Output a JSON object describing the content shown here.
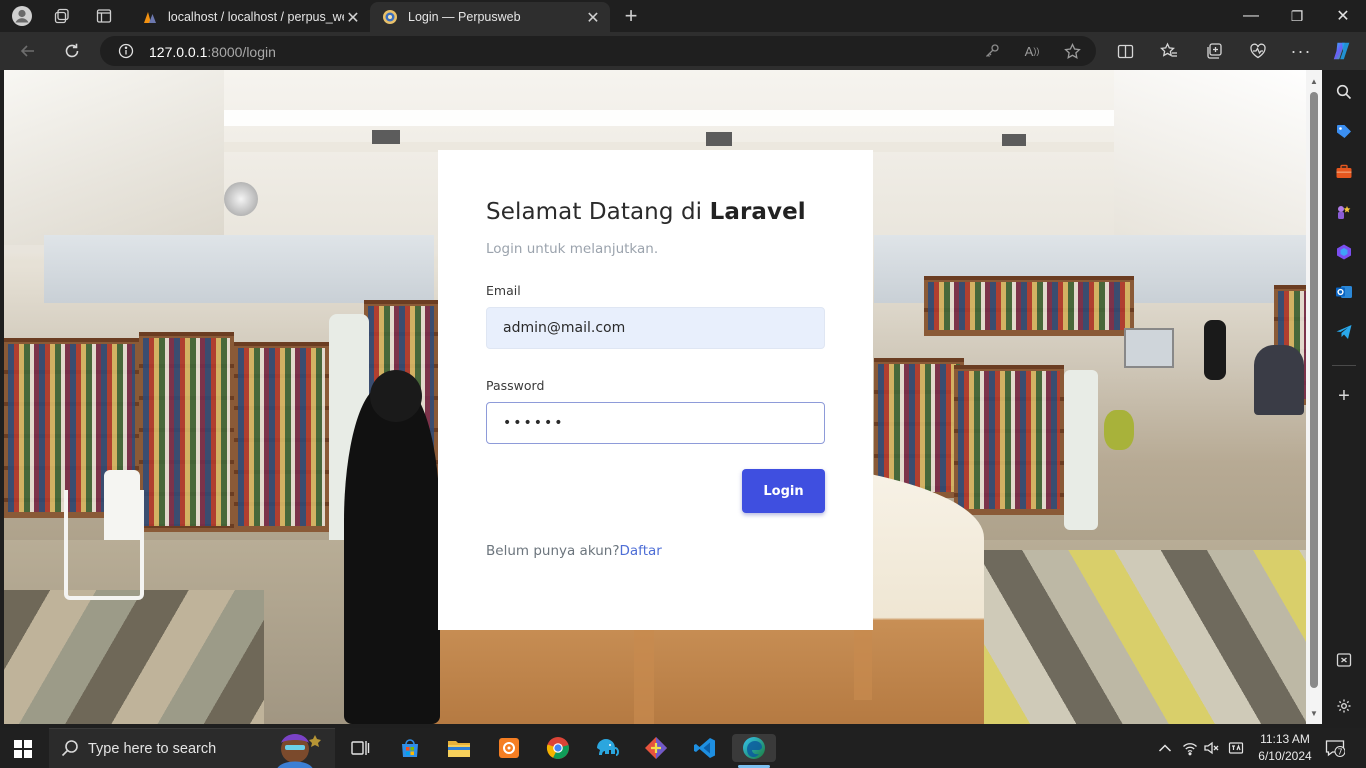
{
  "browser": {
    "tabs": [
      {
        "title": "localhost / localhost / perpus_we",
        "close": "✕"
      },
      {
        "title": "Login — Perpusweb",
        "close": "✕"
      }
    ],
    "new_tab": "+",
    "url_host": "127.0.0.1",
    "url_path": ":8000/login",
    "window_controls": {
      "minimize": "—",
      "maximize": "❐",
      "close": "✕"
    }
  },
  "login": {
    "heading_prefix": "Selamat Datang di ",
    "heading_brand": "Laravel",
    "subtitle": "Login untuk melanjutkan.",
    "email_label": "Email",
    "email_value": "admin@mail.com",
    "password_label": "Password",
    "password_value": "••••••",
    "login_button": "Login",
    "register_prompt": "Belum punya akun?",
    "register_link": "Daftar"
  },
  "taskbar": {
    "search_placeholder": "Type here to search",
    "time": "11:13 AM",
    "date": "6/10/2024",
    "notification_count": "7"
  },
  "colors": {
    "accent": "#3f4fe0",
    "link": "#4e6ed6",
    "email_bg": "#e8effc",
    "browser_dark": "#1f1f1f"
  }
}
